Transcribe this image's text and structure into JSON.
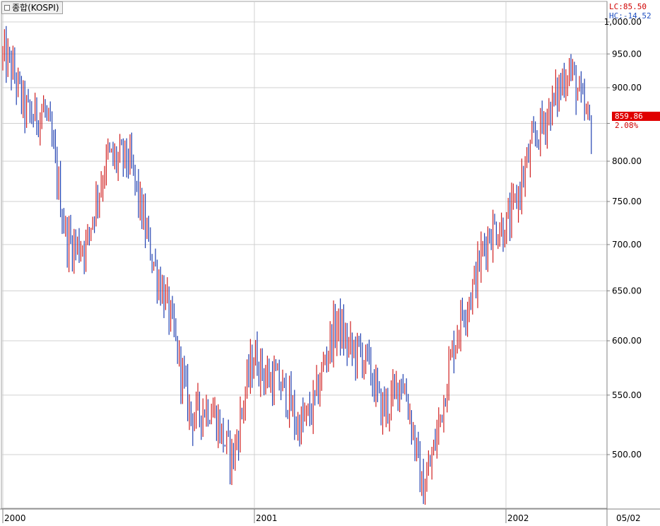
{
  "title": "종합(KOSPI)",
  "lc_text": "LC:85.50",
  "hc_text": "HC:-14.52",
  "last_price": "859.86",
  "last_change": "2.08%",
  "colors": {
    "up": "#d02020",
    "down": "#2040b0",
    "grid": "#d0d0d0",
    "axis_text": "#000000",
    "price_box": "#e00000"
  },
  "chart_data": {
    "type": "ohlc",
    "title": "종합(KOSPI)",
    "y_scale": "log",
    "ylim": [
      450,
      1010
    ],
    "y_ticks": [
      {
        "value": 1000,
        "label": "1,000.00"
      },
      {
        "value": 950,
        "label": "950.00"
      },
      {
        "value": 900,
        "label": "900.00"
      },
      {
        "value": 850,
        "label": ""
      },
      {
        "value": 800,
        "label": "800.00"
      },
      {
        "value": 750,
        "label": "750.00"
      },
      {
        "value": 700,
        "label": "700.00"
      },
      {
        "value": 650,
        "label": "650.00"
      },
      {
        "value": 600,
        "label": "600.00"
      },
      {
        "value": 550,
        "label": "550.00"
      },
      {
        "value": 500,
        "label": "500.00"
      }
    ],
    "x_range": [
      "2000-01",
      "2002-05"
    ],
    "x_ticks": [
      {
        "date": "2000-01",
        "label": "2000"
      },
      {
        "date": "2001-01",
        "label": "2001"
      },
      {
        "date": "2002-01",
        "label": "2002"
      }
    ],
    "x_end_label": "05/02",
    "grid": true,
    "series": [
      {
        "date": "2000-01",
        "close": 940
      },
      {
        "date": "2000-02",
        "close": 880
      },
      {
        "date": "2000-03",
        "close": 860
      },
      {
        "date": "2000-04",
        "close": 720
      },
      {
        "date": "2000-05",
        "close": 690
      },
      {
        "date": "2000-06",
        "close": 820
      },
      {
        "date": "2000-07",
        "close": 790
      },
      {
        "date": "2000-08",
        "close": 710
      },
      {
        "date": "2000-09",
        "close": 610
      },
      {
        "date": "2000-10",
        "close": 540
      },
      {
        "date": "2000-11",
        "close": 530
      },
      {
        "date": "2000-12",
        "close": 505
      },
      {
        "date": "2001-01",
        "close": 580
      },
      {
        "date": "2001-02",
        "close": 570
      },
      {
        "date": "2001-03",
        "close": 520
      },
      {
        "date": "2001-04",
        "close": 555
      },
      {
        "date": "2001-05",
        "close": 615
      },
      {
        "date": "2001-06",
        "close": 590
      },
      {
        "date": "2001-07",
        "close": 540
      },
      {
        "date": "2001-08",
        "close": 565
      },
      {
        "date": "2001-09",
        "close": 475
      },
      {
        "date": "2001-10",
        "close": 540
      },
      {
        "date": "2001-11",
        "close": 640
      },
      {
        "date": "2001-12",
        "close": 695
      },
      {
        "date": "2002-01",
        "close": 730
      },
      {
        "date": "2002-02",
        "close": 785
      },
      {
        "date": "2002-03",
        "close": 880
      },
      {
        "date": "2002-04",
        "close": 915
      },
      {
        "date": "2002-05",
        "close": 859.86
      }
    ]
  }
}
